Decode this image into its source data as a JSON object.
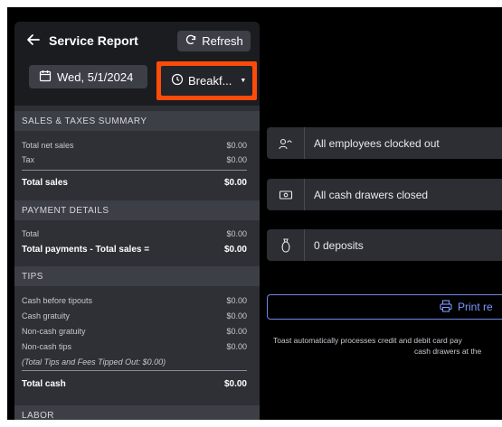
{
  "header": {
    "title": "Service Report",
    "refresh_label": "Refresh",
    "date_label": "Wed, 5/1/2024",
    "meal_label": "Breakf...",
    "highlight_color": "#ff4b0a"
  },
  "sales_taxes": {
    "heading": "SALES & TAXES SUMMARY",
    "rows": [
      {
        "label": "Total net sales",
        "value": "$0.00"
      },
      {
        "label": "Tax",
        "value": "$0.00"
      }
    ],
    "total": {
      "label": "Total sales",
      "value": "$0.00"
    }
  },
  "payment_details": {
    "heading": "PAYMENT DETAILS",
    "rows": [
      {
        "label": "Total",
        "value": "$0.00"
      }
    ],
    "total": {
      "label": "Total payments - Total sales =",
      "value": "$0.00"
    }
  },
  "tips": {
    "heading": "TIPS",
    "rows": [
      {
        "label": "Cash before tipouts",
        "value": "$0.00"
      },
      {
        "label": "Cash gratuity",
        "value": "$0.00"
      },
      {
        "label": "Non-cash gratuity",
        "value": "$0.00"
      },
      {
        "label": "Non-cash tips",
        "value": "$0.00"
      }
    ],
    "note": "(Total Tips and Fees Tipped Out: $0.00)",
    "total": {
      "label": "Total cash",
      "value": "$0.00"
    }
  },
  "next_section": {
    "heading": "LABOR"
  },
  "status_cards": [
    {
      "icon": "employees-icon",
      "label": "All employees clocked out"
    },
    {
      "icon": "cash-drawer-icon",
      "label": "All cash drawers closed"
    },
    {
      "icon": "deposit-bag-icon",
      "label": "0 deposits"
    }
  ],
  "print": {
    "label": "Print re"
  },
  "footer_note": {
    "line1": "Toast automatically processes credit and debit card pay",
    "line2": "cash drawers at the"
  }
}
